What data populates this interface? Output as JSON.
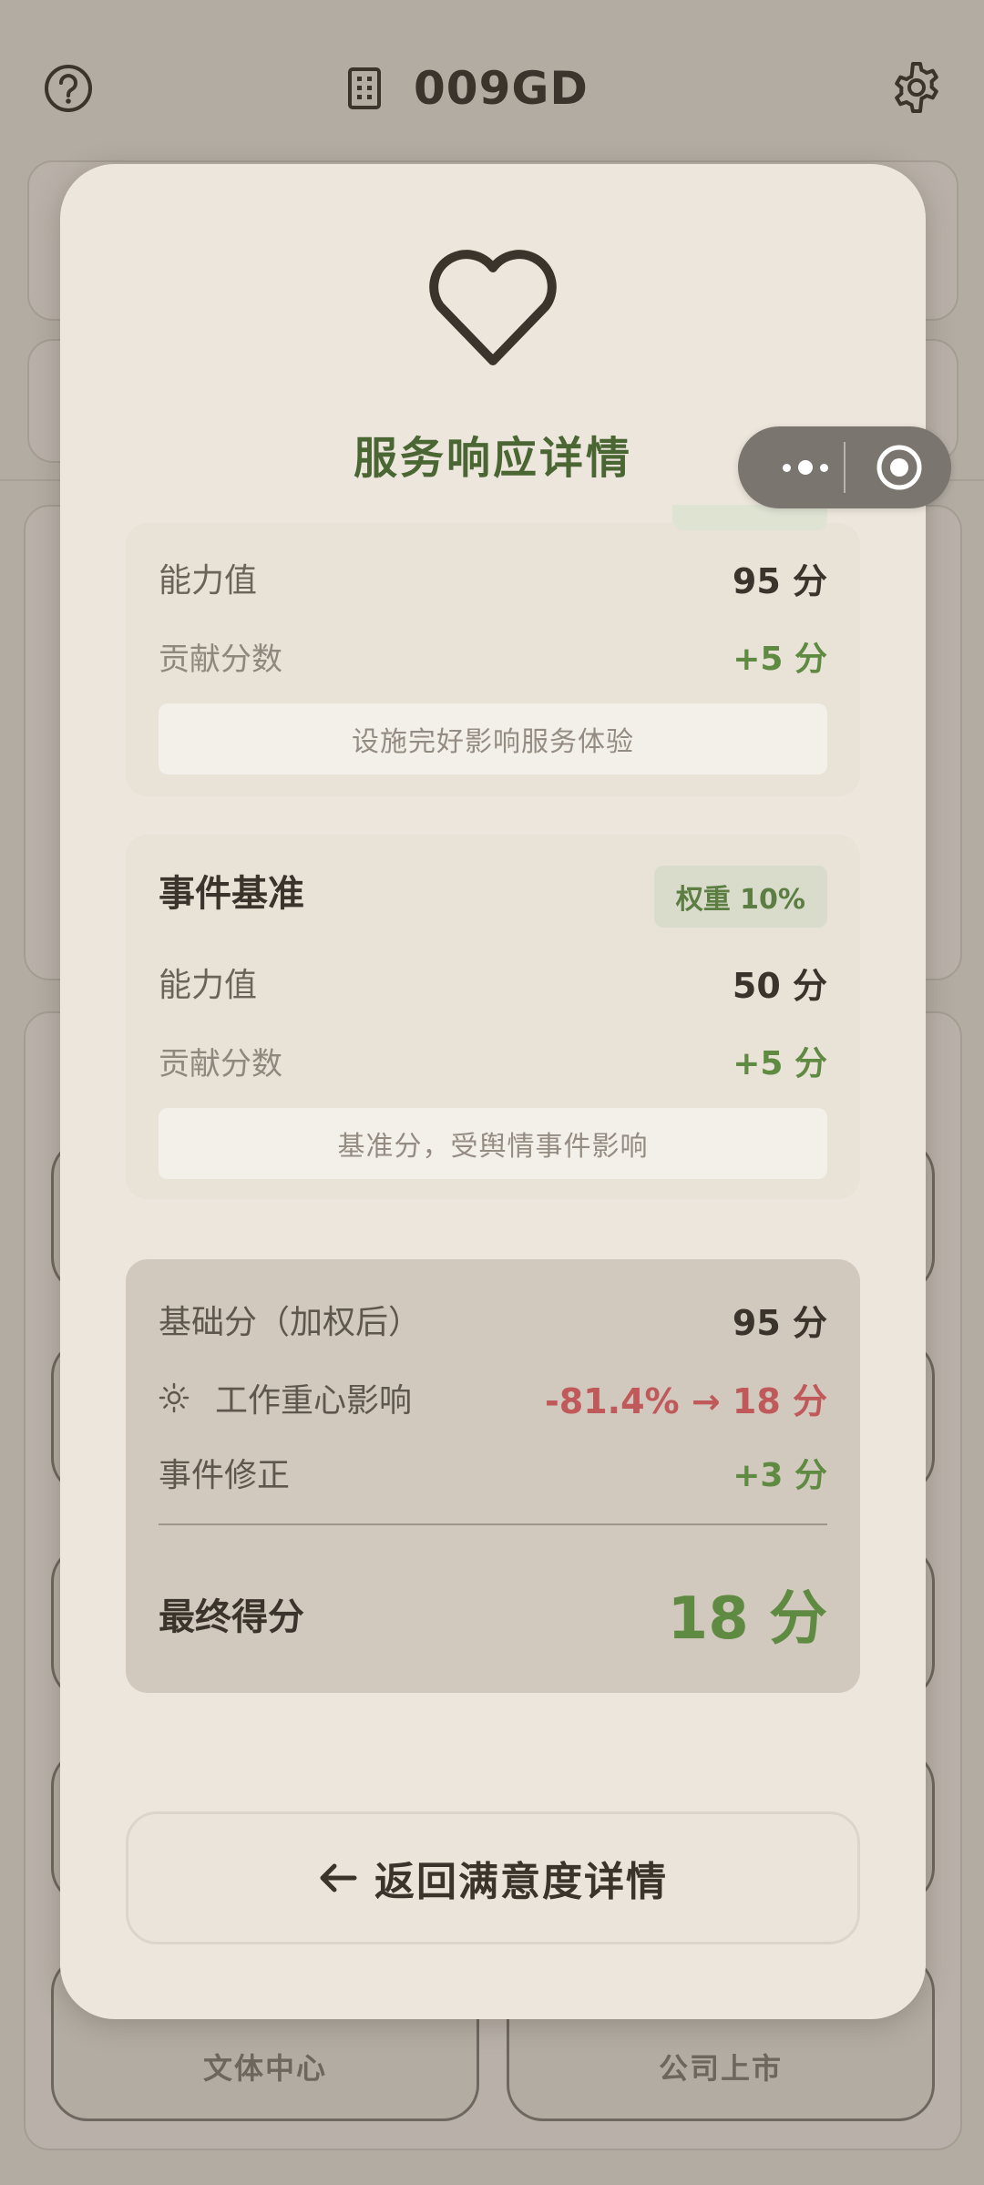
{
  "app": {
    "title": "009GD",
    "bottom_tiles": [
      {
        "label": "文体中心"
      },
      {
        "label": "公司上市"
      }
    ]
  },
  "modal": {
    "title": "服务响应详情",
    "facility": {
      "ability_label": "能力值",
      "ability_value": "95 分",
      "contribution_label": "贡献分数",
      "contribution_value": "+5 分",
      "note": "设施完好影响服务体验"
    },
    "event_baseline": {
      "title": "事件基准",
      "weight": "权重 10%",
      "ability_label": "能力值",
      "ability_value": "50 分",
      "contribution_label": "贡献分数",
      "contribution_value": "+5 分",
      "note": "基准分，受舆情事件影响"
    },
    "summary": {
      "base_label": "基础分（加权后）",
      "base_value": "95 分",
      "focus_label": "工作重心影响",
      "focus_value": "-81.4% → 18 分",
      "event_label": "事件修正",
      "event_value": "+3 分",
      "final_label": "最终得分",
      "final_value": "18 分"
    },
    "back_button": "返回满意度详情"
  },
  "colors": {
    "accent_green": "#5f8a42",
    "title_green": "#4a6633",
    "negative_red": "#c0595a",
    "modal_bg": "#ede6dc",
    "overlay_bg": "#b3aca3"
  },
  "icons": [
    "help-icon",
    "building-icon",
    "gear-icon",
    "heart-icon",
    "sun-icon",
    "arrow-left-icon",
    "more-dots-icon",
    "close-target-icon"
  ]
}
